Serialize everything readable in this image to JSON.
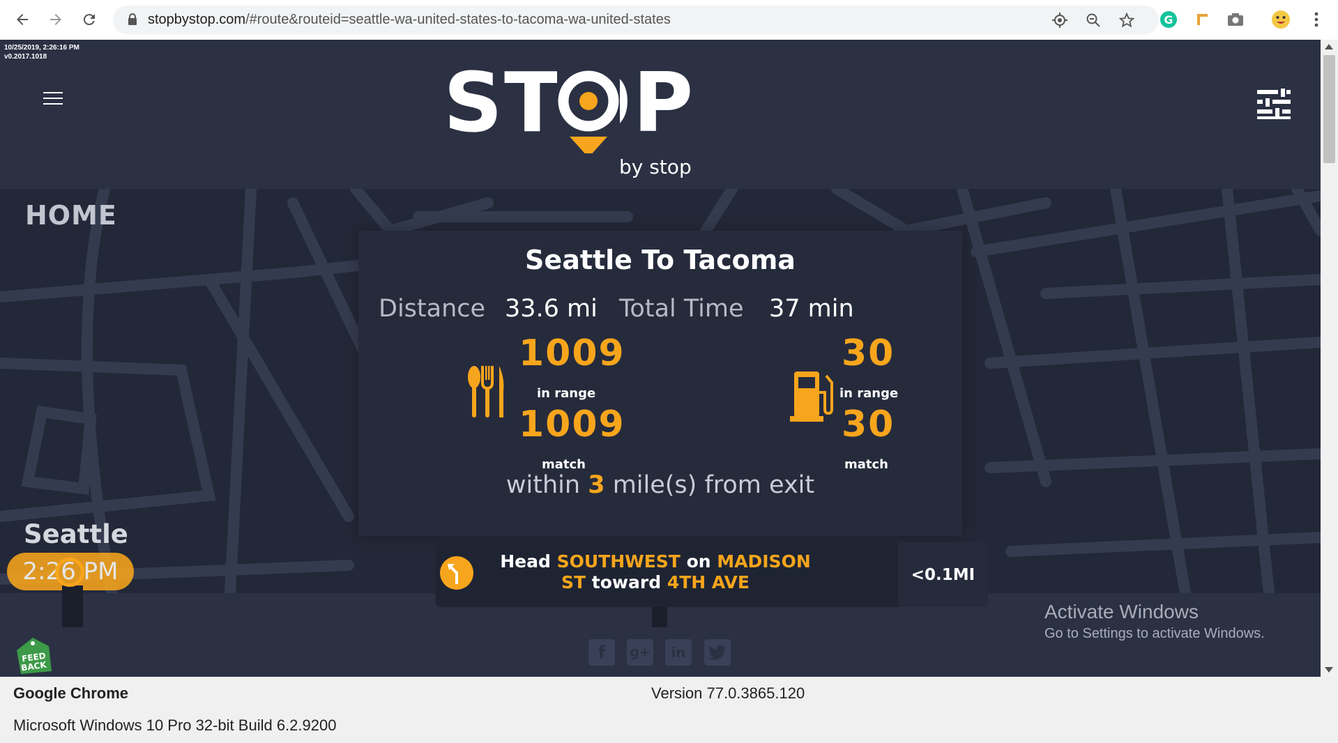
{
  "browser": {
    "url_host": "stopbystop.com",
    "url_path": "/#route&routeid=seattle-wa-united-states-to-tacoma-wa-united-states"
  },
  "header": {
    "timestamp": "10/25/2019, 2:26:16 PM",
    "version": "v0.2017.1018",
    "logo_word": "STOP",
    "logo_sub": "by stop"
  },
  "map": {
    "home_label": "HOME",
    "origin_city": "Seattle",
    "origin_time": "2:26 PM"
  },
  "route": {
    "title": "Seattle To Tacoma",
    "distance_label": "Distance",
    "distance_value": "33.6 mi",
    "time_label": "Total Time",
    "time_value": "37 min",
    "food": {
      "in_range": "1009",
      "in_range_label": "in range",
      "match": "1009",
      "match_label": "match"
    },
    "fuel": {
      "in_range": "30",
      "in_range_label": "in range",
      "match": "30",
      "match_label": "match"
    },
    "within_prefix": "within",
    "within_miles": "3",
    "within_suffix": "mile(s) from exit"
  },
  "direction": {
    "head": "Head",
    "bearing": "SOUTHWEST",
    "on": "on",
    "street": "MADISON ST",
    "toward": "toward",
    "target": "4TH AVE",
    "distance": "<0.1MI"
  },
  "social_icons": [
    "facebook-icon",
    "google-plus-icon",
    "linkedin-icon",
    "twitter-icon"
  ],
  "feedback": "FEED BACK",
  "windows_watermark": {
    "title": "Activate Windows",
    "subtitle": "Go to Settings to activate Windows."
  },
  "caption": {
    "app": "Google Chrome",
    "version": "Version 77.0.3865.120",
    "os": "Microsoft Windows 10 Pro 32-bit Build 6.2.9200"
  },
  "colors": {
    "accent": "#f7a51c",
    "page_bg": "#2b3143",
    "card_bg": "#262b3c"
  }
}
